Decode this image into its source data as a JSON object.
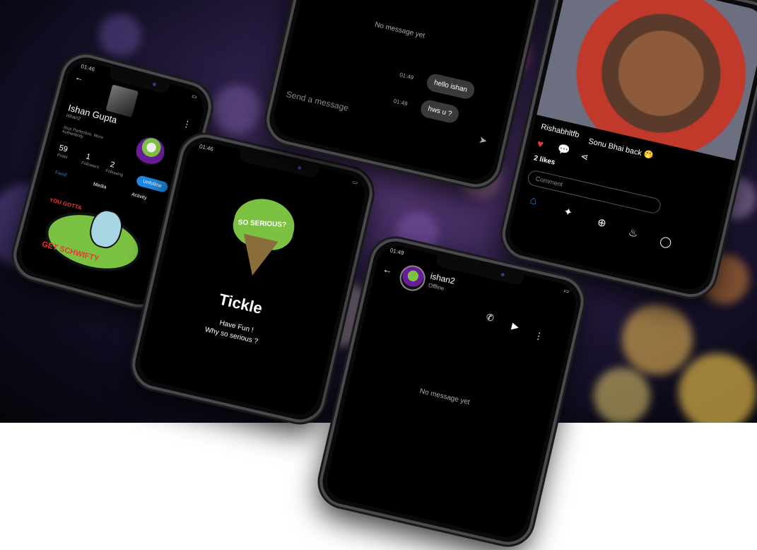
{
  "profile": {
    "status_time": "01:46",
    "name": "Ishan Gupta",
    "username": "ishan2",
    "bio": "Jnus Perfection. More Authenticity",
    "posts_count": "59",
    "posts_label": "Posts",
    "followers_count": "1",
    "followers_label": "Followers",
    "following_count": "2",
    "following_label": "Following",
    "unfollow_label": "Unfollow",
    "tab_feed": "Feed",
    "tab_media": "Media",
    "tab_activity": "Activity",
    "sticker_top": "YOU GOTTA",
    "sticker_bottom": "GET SCHWIFTY"
  },
  "splash": {
    "status_time": "01:46",
    "logo_text": "SO SERIOUS?",
    "app_name": "Tickle",
    "tagline_1": "Have Fun !",
    "tagline_2": "Why so serious ?"
  },
  "chat_top": {
    "empty_text": "No message yet",
    "messages": [
      {
        "time": "01:49",
        "text": "hello ishan"
      },
      {
        "time": "01:49",
        "text": "hws u ?"
      }
    ],
    "input_placeholder": "Send a message"
  },
  "post": {
    "username": "Rishabhltfb",
    "caption": "Sonu Bhai back 🤭",
    "likes": "2 likes",
    "comment_placeholder": "Comment"
  },
  "chat_bottom": {
    "status_time": "01:49",
    "contact_name": "ishan2",
    "contact_status": "Offline",
    "empty_text": "No message yet"
  },
  "colors": {
    "accent": "#1e88e5",
    "like": "#e53935",
    "bubble": "#3a3a3c",
    "joker_green": "#7cc242"
  }
}
